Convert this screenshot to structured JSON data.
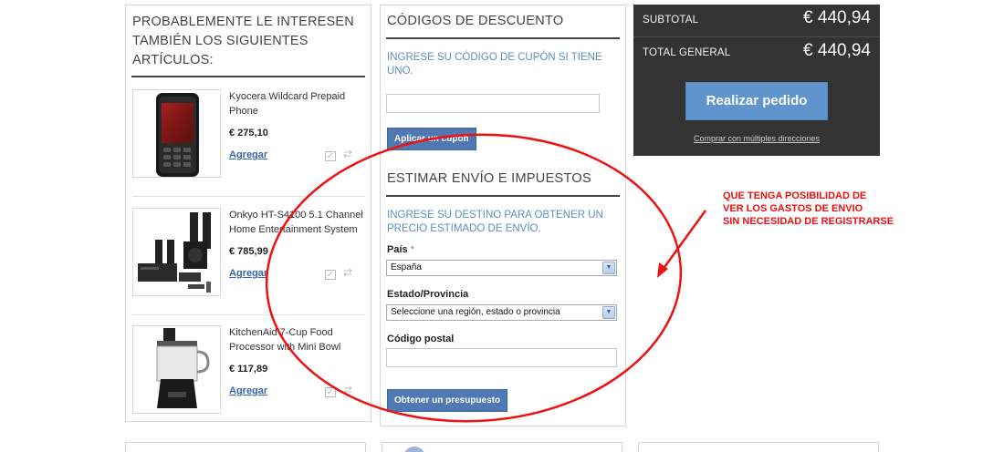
{
  "crosssell": {
    "title": "PROBABLEMENTE LE INTERESEN TAMBIÉN LOS SIGUIENTES ARTÍCULOS:",
    "items": [
      {
        "name": "Kyocera Wildcard Prepaid Phone",
        "price": "€ 275,10",
        "add_label": "Agregar",
        "wishlist_icon": "wishlist-icon",
        "compare_icon": "compare-icon"
      },
      {
        "name": "Onkyo HT-S4100 5.1 Channel Home Entertainment System",
        "price": "€ 785,99",
        "add_label": "Agregar",
        "wishlist_icon": "wishlist-icon",
        "compare_icon": "compare-icon"
      },
      {
        "name": "KitchenAid 7-Cup Food Processor with Mini Bowl",
        "price": "€ 117,89",
        "add_label": "Agregar",
        "wishlist_icon": "wishlist-icon",
        "compare_icon": "compare-icon"
      }
    ]
  },
  "discount": {
    "title": "CÓDIGOS DE DESCUENTO",
    "hint": "INGRESE SU CÓDIGO DE CUPÓN SI TIENE UNO.",
    "code_value": "",
    "apply_label": "Aplicar un cupón"
  },
  "shipping": {
    "title": "ESTIMAR ENVÍO E IMPUESTOS",
    "hint": "INGRESE SU DESTINO PARA OBTENER UN PRECIO ESTIMADO DE ENVÍO.",
    "country_label": "País",
    "required_mark": "*",
    "country_value": "España",
    "region_label": "Estado/Provincia",
    "region_value": "Seleccione una región, estado o provincia",
    "postcode_label": "Código postal",
    "postcode_value": "",
    "quote_label": "Obtener un presupuesto"
  },
  "totals": {
    "subtotal_label": "SUBTOTAL",
    "subtotal_value": "€ 440,94",
    "grand_label": "TOTAL GENERAL",
    "grand_value": "€ 440,94",
    "checkout_label": "Realizar pedido",
    "multi_label": "Comprar con múltiples direcciones"
  },
  "annotation": {
    "lines": [
      "QUE TENGA POSIBILIDAD DE",
      "VER LOS GASTOS DE ENVIO",
      "SIN NECESIDAD DE REGISTRARSE"
    ],
    "color": "#ee1111"
  },
  "colors": {
    "accent_blue": "#5078b3",
    "checkout_blue": "#5f94cc",
    "hint_blue": "#5b8fc5",
    "totals_bg": "#333333"
  }
}
